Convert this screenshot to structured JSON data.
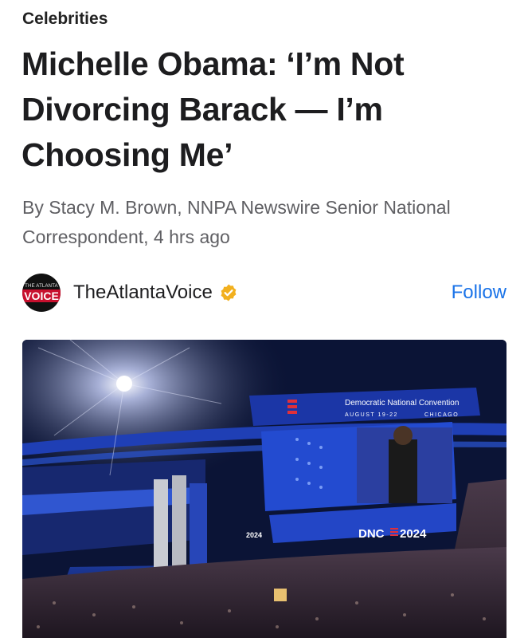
{
  "article": {
    "category": "Celebrities",
    "headline": "Michelle Obama: ‘I’m Not Divorcing Barack — I’m Choosing Me’",
    "byline": "By Stacy M. Brown, NNPA Newswire Senior National Correspondent, 4 hrs ago"
  },
  "source": {
    "avatar_top": "THE ATLANTA",
    "avatar_main": "VOICE",
    "name": "TheAtlantaVoice",
    "verified_icon": "verified-badge-icon",
    "follow_label": "Follow"
  },
  "hero_image": {
    "screen_title": "Democratic National Convention",
    "screen_dates": "AUGUST 19-22",
    "screen_city": "CHICAGO",
    "banner_logo": "DNC",
    "banner_year": "2024",
    "side_logo_year": "2024"
  },
  "colors": {
    "follow": "#1a73e8",
    "byline": "#5f5f63",
    "verified_gold": "#f2b01e",
    "dnc_red": "#e0303a",
    "stage_blue": "#2f52c8"
  }
}
